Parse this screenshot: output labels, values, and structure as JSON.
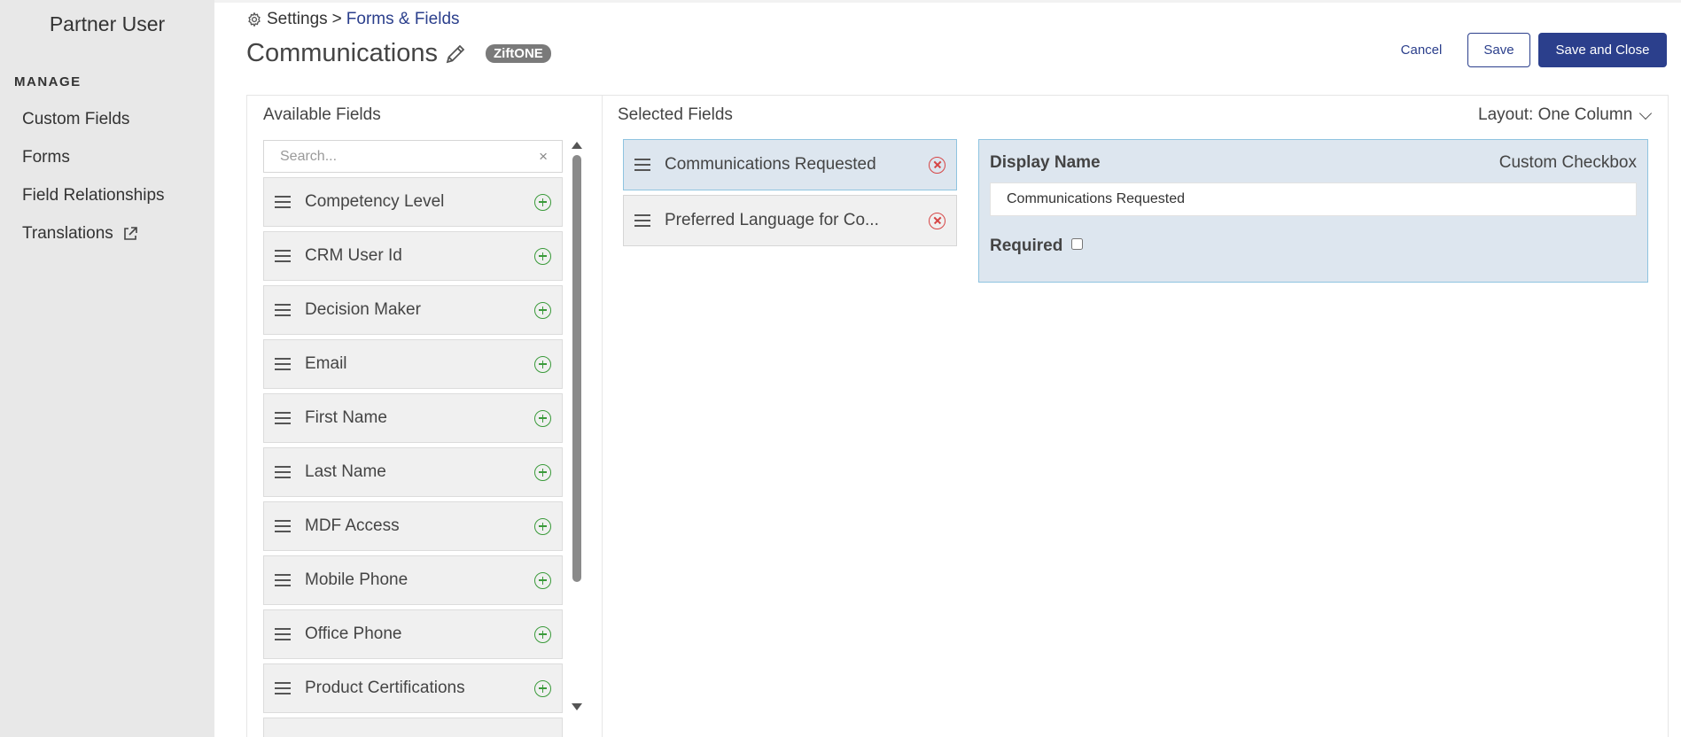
{
  "sidebar": {
    "title": "Partner User",
    "section_label": "MANAGE",
    "items": [
      {
        "label": "Custom Fields"
      },
      {
        "label": "Forms"
      },
      {
        "label": "Field Relationships"
      },
      {
        "label": "Translations",
        "icon": "external-link-icon"
      }
    ]
  },
  "breadcrumb": {
    "icon": "gear-icon",
    "root": "Settings",
    "separator": ">",
    "current": "Forms & Fields"
  },
  "header": {
    "title": "Communications",
    "edit_icon": "pencil-icon",
    "badge": "ZiftONE",
    "cancel_label": "Cancel",
    "save_label": "Save",
    "save_close_label": "Save and Close"
  },
  "available": {
    "heading": "Available Fields",
    "search_placeholder": "Search...",
    "search_value": "",
    "clear_symbol": "×",
    "items": [
      {
        "label": "Competency Level"
      },
      {
        "label": "CRM User Id"
      },
      {
        "label": "Decision Maker"
      },
      {
        "label": "Email"
      },
      {
        "label": "First Name"
      },
      {
        "label": "Last Name"
      },
      {
        "label": "MDF Access"
      },
      {
        "label": "Mobile Phone"
      },
      {
        "label": "Office Phone"
      },
      {
        "label": "Product Certifications"
      }
    ]
  },
  "selected": {
    "heading": "Selected Fields",
    "layout_label": "Layout: One Column",
    "items": [
      {
        "label": "Communications Requested",
        "active": true
      },
      {
        "label": "Preferred Language for Co...",
        "active": false
      }
    ]
  },
  "properties": {
    "display_name_label": "Display Name",
    "field_type": "Custom Checkbox",
    "display_name_value": "Communications Requested",
    "required_label": "Required",
    "required_checked": false
  },
  "colors": {
    "accent": "#2b3f8c",
    "add": "#3a9a3a",
    "remove": "#d64545",
    "selected_bg": "#dde6ef",
    "selected_border": "#8fc4e0"
  }
}
